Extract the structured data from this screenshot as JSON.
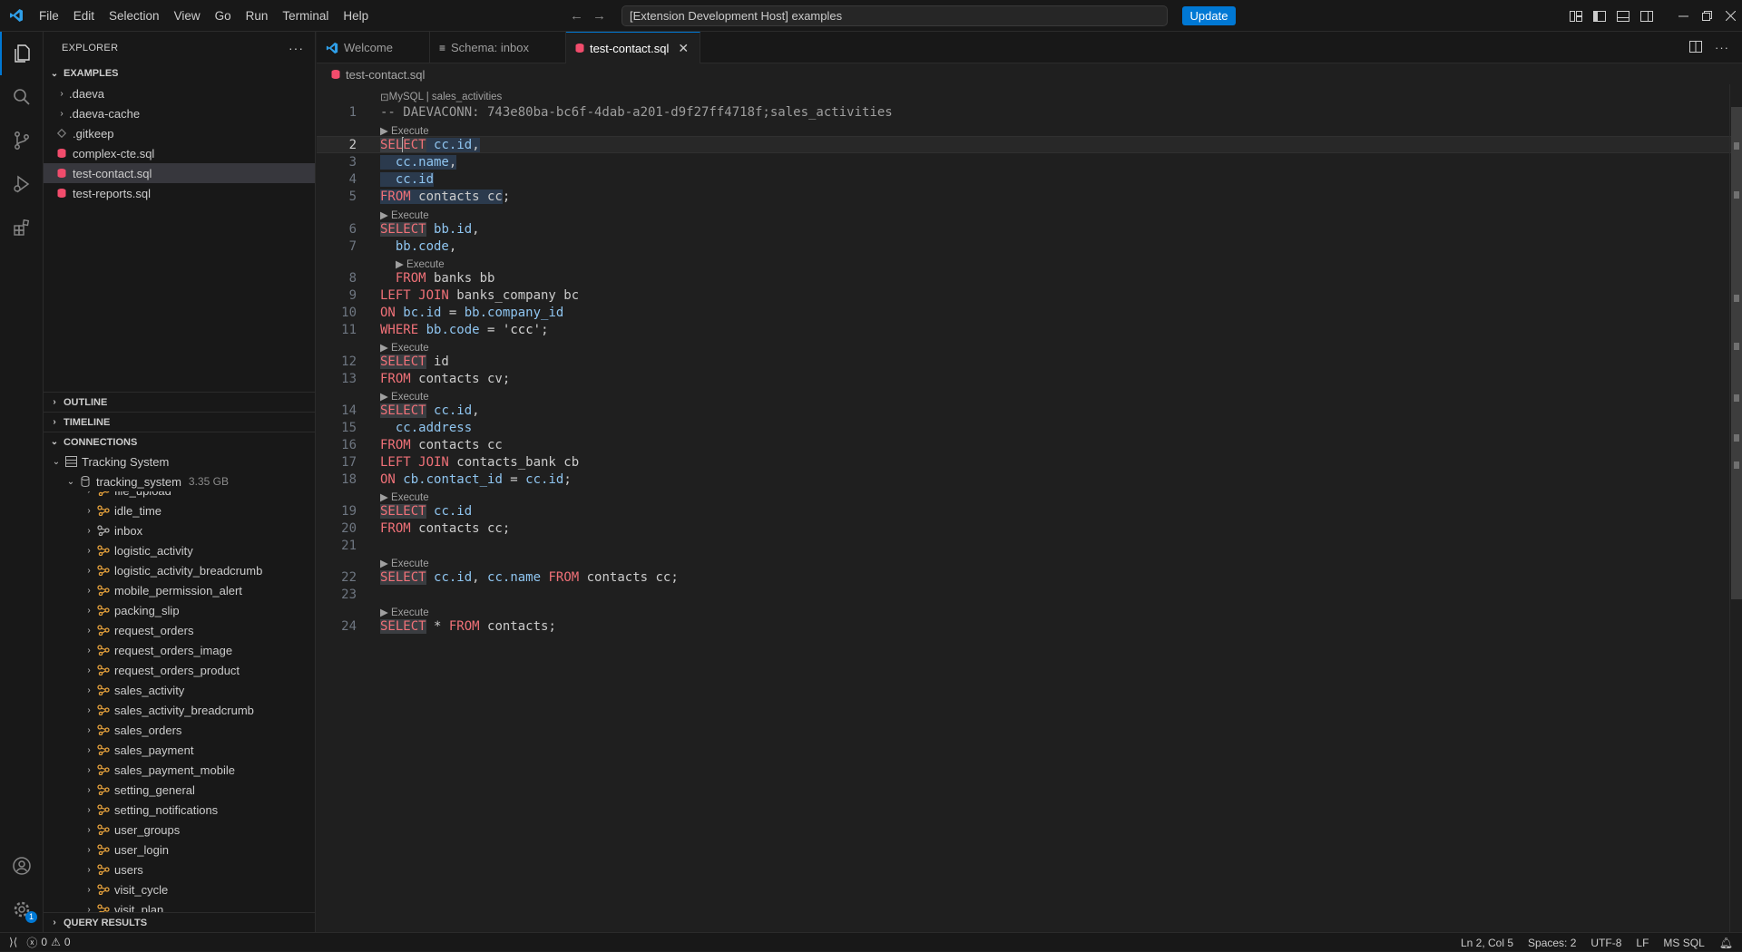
{
  "titlebar": {
    "menu": [
      "File",
      "Edit",
      "Selection",
      "View",
      "Go",
      "Run",
      "Terminal",
      "Help"
    ],
    "command_center": "[Extension Development Host] examples",
    "update_label": "Update"
  },
  "activity": {
    "accounts_badge": "1"
  },
  "explorer": {
    "title": "EXPLORER",
    "folder_label": "EXAMPLES",
    "items": [
      {
        "label": ".daeva",
        "kind": "folder"
      },
      {
        "label": ".daeva-cache",
        "kind": "folder"
      },
      {
        "label": ".gitkeep",
        "kind": "file"
      },
      {
        "label": "complex-cte.sql",
        "kind": "sql"
      },
      {
        "label": "test-contact.sql",
        "kind": "sql"
      },
      {
        "label": "test-reports.sql",
        "kind": "sql"
      }
    ]
  },
  "sections": {
    "outline": "OUTLINE",
    "timeline": "TIMELINE",
    "connections": "CONNECTIONS",
    "query_results": "QUERY RESULTS"
  },
  "connections": {
    "server": "Tracking System",
    "database": "tracking_system",
    "database_size": "3.35 GB",
    "tables": [
      "file_upload",
      "idle_time",
      "inbox",
      "logistic_activity",
      "logistic_activity_breadcrumb",
      "mobile_permission_alert",
      "packing_slip",
      "request_orders",
      "request_orders_image",
      "request_orders_product",
      "sales_activity",
      "sales_activity_breadcrumb",
      "sales_orders",
      "sales_payment",
      "sales_payment_mobile",
      "setting_general",
      "setting_notifications",
      "user_groups",
      "user_login",
      "users",
      "visit_cycle",
      "visit_plan"
    ]
  },
  "tabs": [
    {
      "label": "Welcome"
    },
    {
      "label": "Schema: inbox"
    },
    {
      "label": "test-contact.sql"
    }
  ],
  "editor": {
    "breadcrumb": "test-contact.sql",
    "codelens_connection": "MySQL | sales_activities",
    "codelens_execute": "▶ Execute",
    "line_numbers": [
      "1",
      "2",
      "3",
      "4",
      "5",
      "6",
      "7",
      "8",
      "9",
      "10",
      "11",
      "12",
      "13",
      "14",
      "15",
      "16",
      "17",
      "18",
      "19",
      "20",
      "21",
      "22",
      "23",
      "24"
    ],
    "line1": "-- DAEVACONN: 743e80ba-bc6f-4dab-a201-d9f27ff4718f;sales_activities"
  },
  "statusbar": {
    "errors": "0",
    "warnings": "0",
    "position": "Ln 2, Col 5",
    "spaces": "Spaces: 2",
    "encoding": "UTF-8",
    "eol": "LF",
    "language": "MS SQL"
  }
}
